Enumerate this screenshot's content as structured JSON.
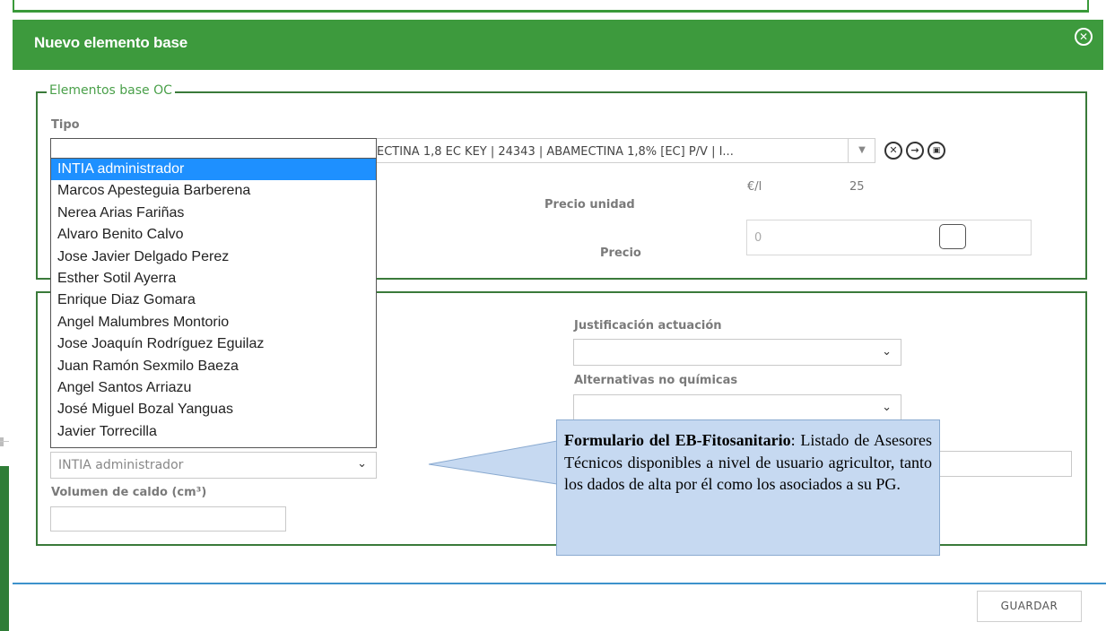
{
  "dialog": {
    "title": "Nuevo elemento base",
    "close_icon": "close-circle-icon"
  },
  "section1": {
    "legend": "Elementos base OC",
    "tipo_label": "Tipo",
    "tipo_value": "ECTINA 1,8 EC KEY | 24343 | ABAMECTINA 1,8% [EC] P/V | I...",
    "precio_unidad_label": "Precio unidad",
    "unit": "€/l",
    "unit_value": "25",
    "precio_label": "Precio",
    "precio_placeholder": "0"
  },
  "section2": {
    "justificacion_label": "Justificación actuación",
    "alternativas_label": "Alternativas no químicas",
    "asesor_selected": "INTIA administrador",
    "volumen_label": "Volumen de caldo (cm³)"
  },
  "dropdown": {
    "items": [
      "INTIA administrador",
      "Marcos Apesteguia Barberena",
      "Nerea Arias Fariñas",
      "Alvaro Benito Calvo",
      "Jose Javier Delgado Perez",
      "Esther Sotil Ayerra",
      "Enrique Diaz Gomara",
      "Angel Malumbres Montorio",
      "Jose Joaquín Rodríguez Eguilaz",
      "Juan Ramón Sexmilo Baeza",
      "Angel Santos Arriazu",
      "José Miguel Bozal Yanguas",
      "Javier Torrecilla"
    ],
    "selected_index": 0
  },
  "callout": {
    "bold": "Formulario del EB-Fitosanitario",
    "text": ": Listado de Asesores Técnicos disponibles a nivel de usuario agricultor, tanto los dados de alta por él como los asociados a su PG."
  },
  "footer": {
    "save_label": "GUARDAR"
  },
  "icons": {
    "clear": "clear-circle-icon",
    "go": "arrow-right-circle-icon",
    "doc": "document-circle-icon",
    "chevron": "chevron-down-icon"
  },
  "colors": {
    "header": "#3d9a3d",
    "border": "#3a7a3a",
    "legend": "#4aa04a",
    "selection": "#1e90ff",
    "callout": "#c6d9f1",
    "footer_line": "#3d92cc"
  }
}
